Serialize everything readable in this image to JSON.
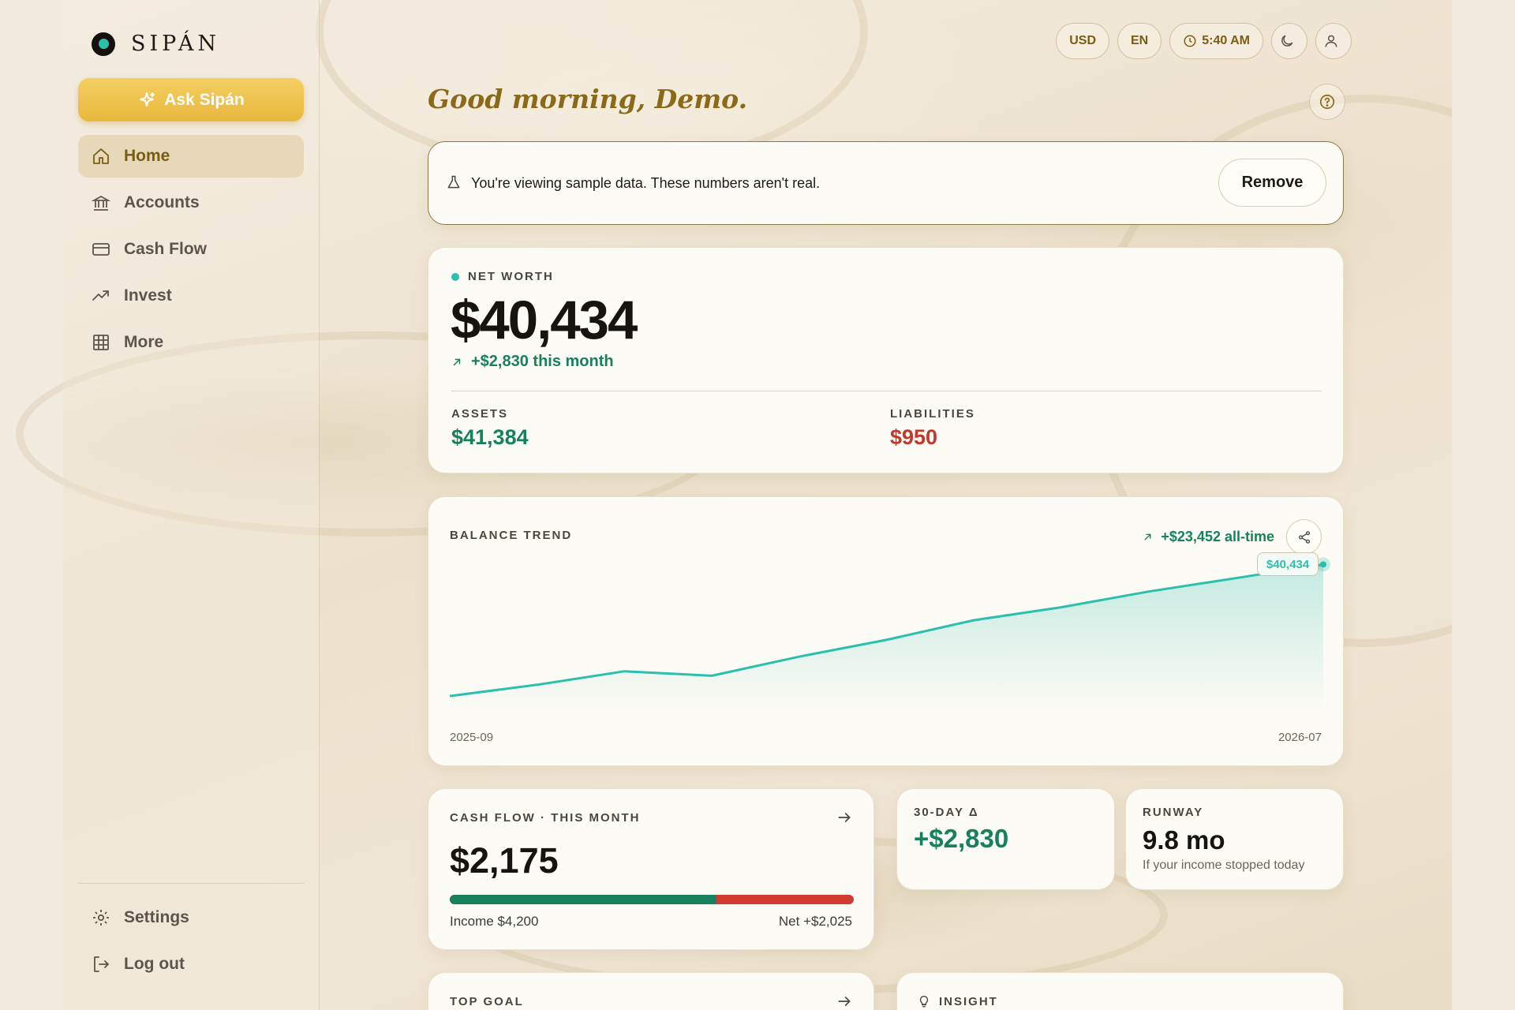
{
  "app": {
    "name": "SIPÁN",
    "ask_label": "Ask Sipán"
  },
  "sidebar": {
    "items": [
      {
        "label": "Home",
        "icon": "home-icon",
        "active": true
      },
      {
        "label": "Accounts",
        "icon": "bank-icon"
      },
      {
        "label": "Cash Flow",
        "icon": "card-icon"
      },
      {
        "label": "Invest",
        "icon": "trending-up-icon"
      },
      {
        "label": "More",
        "icon": "grid-icon"
      }
    ],
    "bottom": [
      {
        "label": "Settings",
        "icon": "gear-icon"
      },
      {
        "label": "Log out",
        "icon": "logout-icon"
      }
    ]
  },
  "topbar": {
    "currency": "USD",
    "language": "EN",
    "time": "5:40 AM"
  },
  "greeting": "Good morning, Demo.",
  "banner": {
    "text": "You're viewing sample data. These numbers aren't real.",
    "remove_label": "Remove"
  },
  "net_worth": {
    "label": "NET WORTH",
    "value": "$40,434",
    "change": "+$2,830 this month",
    "assets_label": "ASSETS",
    "assets_value": "$41,384",
    "liabilities_label": "LIABILITIES",
    "liabilities_value": "$950"
  },
  "balance_trend": {
    "label": "BALANCE TREND",
    "delta": "+$23,452 all-time",
    "end_tag": "$40,434",
    "x_start": "2025-09",
    "x_end": "2026-07"
  },
  "cash_flow": {
    "label": "CASH FLOW · THIS MONTH",
    "value": "$2,175",
    "income": "Income $4,200",
    "net": "Net +$2,025",
    "income_fraction": 0.66
  },
  "delta_30": {
    "label": "30-DAY Δ",
    "value": "+$2,830"
  },
  "runway": {
    "label": "RUNWAY",
    "value": "9.8 mo",
    "sub": "If your income stopped today"
  },
  "top_goal": {
    "label": "TOP GOAL"
  },
  "insight": {
    "label": "INSIGHT"
  },
  "colors": {
    "accent_gold": "#e8b73c",
    "positive": "#17805d",
    "negative": "#c0392b",
    "chart_line": "#2bbfae"
  },
  "chart_data": {
    "type": "area",
    "title": "BALANCE TREND",
    "x": [
      "2025-09",
      "2025-10",
      "2025-11",
      "2025-12",
      "2026-01",
      "2026-02",
      "2026-03",
      "2026-04",
      "2026-05",
      "2026-06",
      "2026-07"
    ],
    "series": [
      {
        "values": [
          16982,
          19000,
          21400,
          20600,
          24000,
          27000,
          30500,
          32800,
          35600,
          38000,
          40434
        ]
      }
    ],
    "ylim": [
      8000,
      44000
    ],
    "grid": false
  }
}
